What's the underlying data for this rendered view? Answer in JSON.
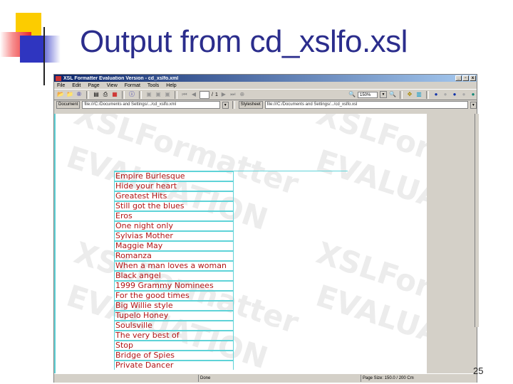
{
  "slide": {
    "title": "Output from cd_xslfo.xsl",
    "number": "25"
  },
  "window": {
    "title": "XSL Formatter Evaluation Version - cd_xslfo.xml",
    "buttons": {
      "minimize": "_",
      "restore": "▫",
      "close": "x"
    }
  },
  "menu": [
    "File",
    "Edit",
    "Page",
    "View",
    "Format",
    "Tools",
    "Help"
  ],
  "toolbar": {
    "page_current": "",
    "page_separator": "/",
    "page_total": "1",
    "zoom": "150%"
  },
  "address": {
    "document_label": "Document",
    "document_path": "file:///C:/Documents and Settings/.../cd_xslfo.xml",
    "stylesheet_label": "Stylesheet",
    "stylesheet_path": "file:///C:/Documents and Settings/.../cd_xslfo.xsl"
  },
  "watermark": {
    "line1": "XSLFormatter",
    "line2": "EVALUATION"
  },
  "cd_titles": [
    "Empire Burlesque",
    "Hide your heart",
    "Greatest Hits",
    "Still got the blues",
    "Eros",
    "One night only",
    "Sylvias Mother",
    "Maggie May",
    "Romanza",
    "When a man loves a woman",
    "Black angel",
    "1999 Grammy Nominees",
    "For the good times",
    "Big Willie style",
    "Tupelo Honey",
    "Soulsville",
    "The very best of",
    "Stop",
    "Bridge of Spies",
    "Private Dancer"
  ],
  "status": {
    "message": "Done",
    "page_size": "Page Size: 150.0 / 200 Cm"
  }
}
